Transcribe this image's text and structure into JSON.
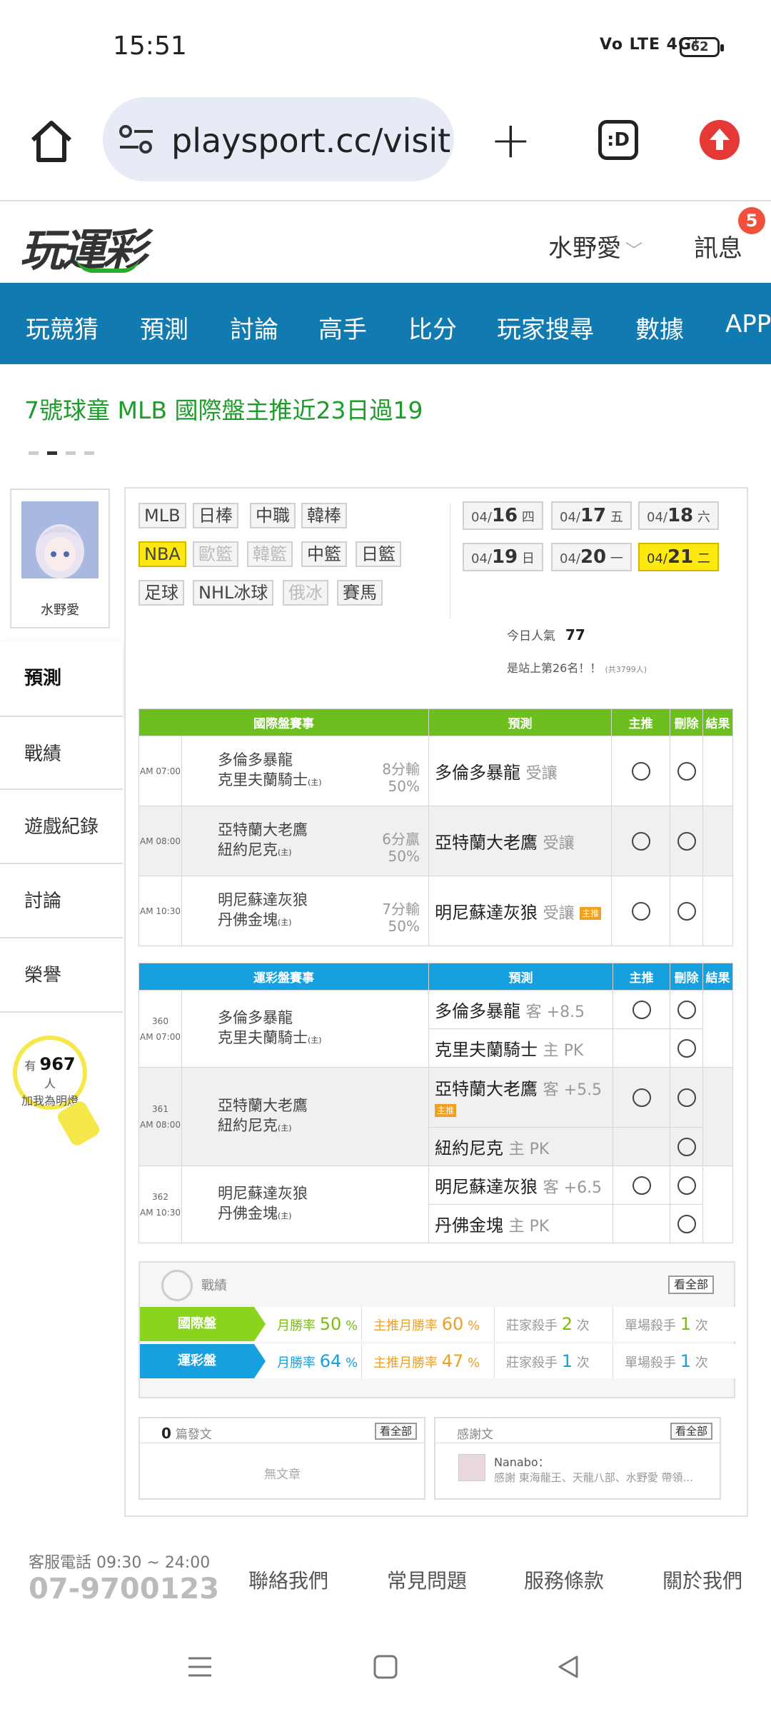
{
  "status": {
    "time": "15:51",
    "signal": "Vo LTE 4G⁺",
    "battery": "62"
  },
  "browser": {
    "url": "playsport.cc/visit",
    "tabs": ":D"
  },
  "site": {
    "logo": "玩運彩",
    "user": "水野愛",
    "messages": "訊息",
    "msg_badge": "5"
  },
  "nav": [
    "玩競猜",
    "預測",
    "討論",
    "高手",
    "比分",
    "玩家搜尋",
    "數據",
    "APP"
  ],
  "promo": "7號球童 MLB 國際盤主推近23日過19",
  "sidebar": {
    "name": "水野愛",
    "items": [
      "預測",
      "戰績",
      "遊戲紀錄",
      "討論",
      "榮譽"
    ],
    "bulb_prefix": "有",
    "bulb_count": "967",
    "bulb_suffix": "人",
    "bulb_line2": "加我為明燈"
  },
  "sports": [
    [
      "MLB",
      "日棒",
      "中職",
      "韓棒"
    ],
    [
      "NBA",
      "歐籃",
      "韓籃",
      "中籃",
      "日籃"
    ],
    [
      "足球",
      "NHL冰球",
      "俄冰",
      "賽馬"
    ]
  ],
  "dates": [
    {
      "md": "04/",
      "d": "16",
      "w": "四"
    },
    {
      "md": "04/",
      "d": "17",
      "w": "五"
    },
    {
      "md": "04/",
      "d": "18",
      "w": "六"
    },
    {
      "md": "04/",
      "d": "19",
      "w": "日"
    },
    {
      "md": "04/",
      "d": "20",
      "w": "一"
    },
    {
      "md": "04/",
      "d": "21",
      "w": "二"
    }
  ],
  "popularity": {
    "label": "今日人氣",
    "value": "77",
    "rank": "是站上第26名！！",
    "rank_note": "(共3799人)"
  },
  "intl": {
    "headers": [
      "國際盤賽事",
      "預測",
      "主推",
      "刪除",
      "結果"
    ],
    "rows": [
      {
        "time": "AM 07:00",
        "away": "多倫多暴龍",
        "home": "克里夫蘭騎士",
        "home_mark": "(主)",
        "line1": "8分輸",
        "line2": "50%",
        "pick": "多倫多暴龍",
        "pick_type": "受讓",
        "hot": ""
      },
      {
        "time": "AM 08:00",
        "away": "亞特蘭大老鷹",
        "home": "紐約尼克",
        "home_mark": "(主)",
        "line1": "6分贏",
        "line2": "50%",
        "pick": "亞特蘭大老鷹",
        "pick_type": "受讓",
        "hot": ""
      },
      {
        "time": "AM 10:30",
        "away": "明尼蘇達灰狼",
        "home": "丹佛金塊",
        "home_mark": "(主)",
        "line1": "7分輸",
        "line2": "50%",
        "pick": "明尼蘇達灰狼",
        "pick_type": "受讓",
        "hot": "主推"
      }
    ]
  },
  "lottery": {
    "headers": [
      "運彩盤賽事",
      "預測",
      "主推",
      "刪除",
      "結果"
    ],
    "games": [
      {
        "no": "360",
        "time": "AM 07:00",
        "away": "多倫多暴龍",
        "home": "克里夫蘭騎士",
        "home_mark": "(主)",
        "pick1": "多倫多暴龍",
        "pick1_h": "客 +8.5",
        "pick2": "克里夫蘭騎士",
        "pick2_h": "主 PK",
        "hot": ""
      },
      {
        "no": "361",
        "time": "AM 08:00",
        "away": "亞特蘭大老鷹",
        "home": "紐約尼克",
        "home_mark": "(主)",
        "pick1": "亞特蘭大老鷹",
        "pick1_h": "客 +5.5",
        "pick2": "紐約尼克",
        "pick2_h": "主 PK",
        "hot": "主推"
      },
      {
        "no": "362",
        "time": "AM 10:30",
        "away": "明尼蘇達灰狼",
        "home": "丹佛金塊",
        "home_mark": "(主)",
        "pick1": "明尼蘇達灰狼",
        "pick1_h": "客 +6.5",
        "pick2": "丹佛金塊",
        "pick2_h": "主 PK",
        "hot": ""
      }
    ]
  },
  "record": {
    "title": "戰績",
    "all": "看全部",
    "rows": [
      {
        "label": "國際盤",
        "win_label": "月勝率",
        "win": "50",
        "main_label": "主推月勝率",
        "main": "60",
        "book_label": "莊家殺手",
        "book": "2",
        "single_label": "單場殺手",
        "single": "1",
        "pct": "%",
        "unit": "次"
      },
      {
        "label": "運彩盤",
        "win_label": "月勝率",
        "win": "64",
        "main_label": "主推月勝率",
        "main": "47",
        "book_label": "莊家殺手",
        "book": "1",
        "single_label": "單場殺手",
        "single": "1",
        "pct": "%",
        "unit": "次"
      }
    ]
  },
  "posts": {
    "count": "0",
    "label": "篇發文",
    "all": "看全部",
    "empty": "無文章"
  },
  "thanks": {
    "label": "感謝文",
    "all": "看全部",
    "user": "Nanabo：",
    "text": "感謝 東海龍王、天龍八部、水野愛 帶領..."
  },
  "footer": {
    "tel_label": "客服電話 09:30 ~ 24:00",
    "tel": "07-9700123",
    "links": [
      "聯絡我們",
      "常見問題",
      "服務條款",
      "關於我們"
    ]
  }
}
